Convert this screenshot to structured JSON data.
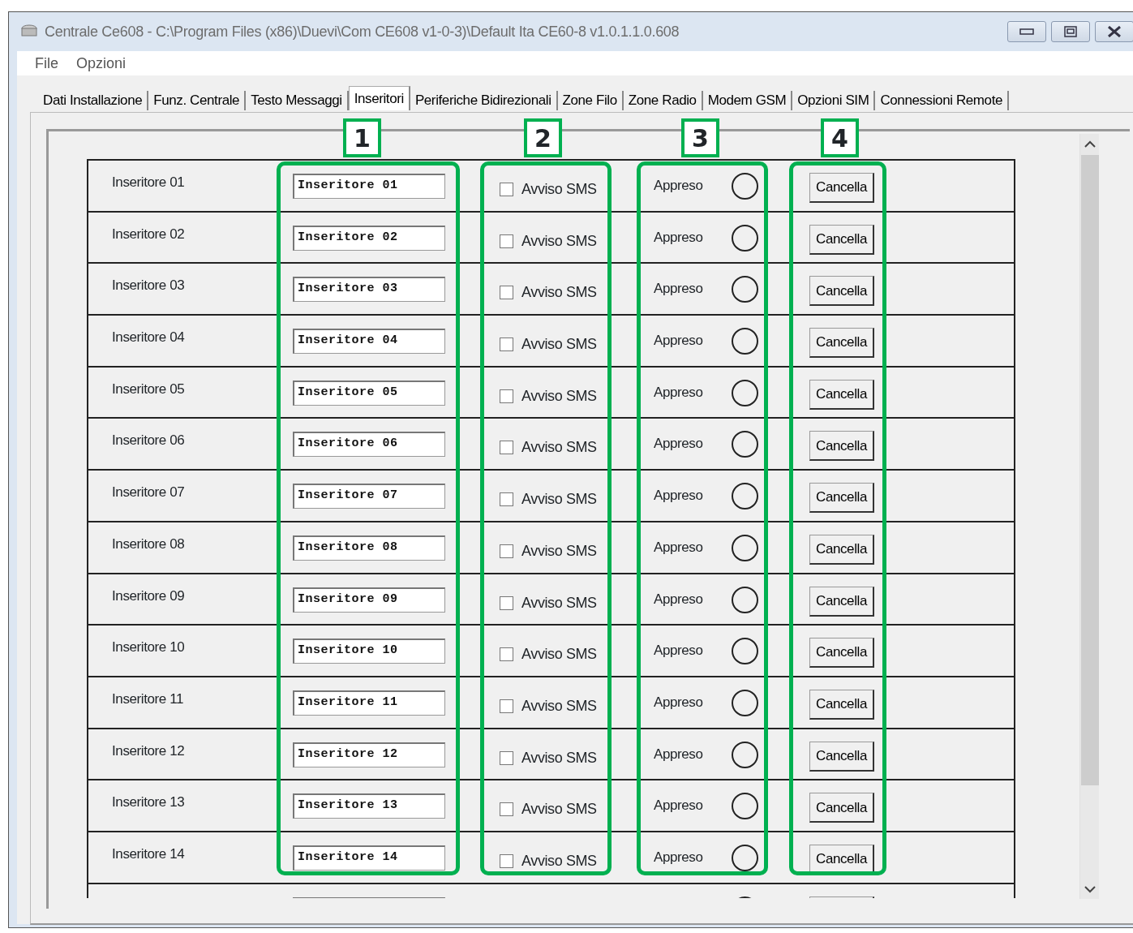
{
  "window": {
    "title": "Centrale Ce608 - C:\\Program Files (x86)\\Duevi\\Com CE608 v1-0-3)\\Default Ita CE60-8 v1.0.1.1.0.608"
  },
  "menu": [
    "File",
    "Opzioni"
  ],
  "tabs": [
    {
      "label": "Dati Installazione",
      "selected": false
    },
    {
      "label": "Funz. Centrale",
      "selected": false
    },
    {
      "label": "Testo Messaggi",
      "selected": false
    },
    {
      "label": "Inseritori",
      "selected": true
    },
    {
      "label": "Periferiche Bidirezionali",
      "selected": false
    },
    {
      "label": "Zone Filo",
      "selected": false
    },
    {
      "label": "Zone Radio",
      "selected": false
    },
    {
      "label": "Modem GSM",
      "selected": false
    },
    {
      "label": "Opzioni SIM",
      "selected": false
    },
    {
      "label": "Connessioni Remote",
      "selected": false
    }
  ],
  "callouts": [
    "1",
    "2",
    "3",
    "4"
  ],
  "rows": [
    {
      "label": "Inseritore 01",
      "name": "Inseritore 01",
      "sms_label": "Avviso SMS",
      "sms_checked": false,
      "status": "Appreso",
      "lit": false,
      "button": "Cancella"
    },
    {
      "label": "Inseritore 02",
      "name": "Inseritore 02",
      "sms_label": "Avviso SMS",
      "sms_checked": false,
      "status": "Appreso",
      "lit": false,
      "button": "Cancella"
    },
    {
      "label": "Inseritore 03",
      "name": "Inseritore 03",
      "sms_label": "Avviso SMS",
      "sms_checked": false,
      "status": "Appreso",
      "lit": false,
      "button": "Cancella"
    },
    {
      "label": "Inseritore 04",
      "name": "Inseritore 04",
      "sms_label": "Avviso SMS",
      "sms_checked": false,
      "status": "Appreso",
      "lit": false,
      "button": "Cancella"
    },
    {
      "label": "Inseritore 05",
      "name": "Inseritore 05",
      "sms_label": "Avviso SMS",
      "sms_checked": false,
      "status": "Appreso",
      "lit": false,
      "button": "Cancella"
    },
    {
      "label": "Inseritore 06",
      "name": "Inseritore 06",
      "sms_label": "Avviso SMS",
      "sms_checked": false,
      "status": "Appreso",
      "lit": false,
      "button": "Cancella"
    },
    {
      "label": "Inseritore 07",
      "name": "Inseritore 07",
      "sms_label": "Avviso SMS",
      "sms_checked": false,
      "status": "Appreso",
      "lit": false,
      "button": "Cancella"
    },
    {
      "label": "Inseritore 08",
      "name": "Inseritore 08",
      "sms_label": "Avviso SMS",
      "sms_checked": false,
      "status": "Appreso",
      "lit": false,
      "button": "Cancella"
    },
    {
      "label": "Inseritore 09",
      "name": "Inseritore 09",
      "sms_label": "Avviso SMS",
      "sms_checked": false,
      "status": "Appreso",
      "lit": false,
      "button": "Cancella"
    },
    {
      "label": "Inseritore 10",
      "name": "Inseritore 10",
      "sms_label": "Avviso SMS",
      "sms_checked": false,
      "status": "Appreso",
      "lit": false,
      "button": "Cancella"
    },
    {
      "label": "Inseritore 11",
      "name": "Inseritore 11",
      "sms_label": "Avviso SMS",
      "sms_checked": false,
      "status": "Appreso",
      "lit": false,
      "button": "Cancella"
    },
    {
      "label": "Inseritore 12",
      "name": "Inseritore 12",
      "sms_label": "Avviso SMS",
      "sms_checked": false,
      "status": "Appreso",
      "lit": false,
      "button": "Cancella"
    },
    {
      "label": "Inseritore 13",
      "name": "Inseritore 13",
      "sms_label": "Avviso SMS",
      "sms_checked": false,
      "status": "Appreso",
      "lit": false,
      "button": "Cancella"
    },
    {
      "label": "Inseritore 14",
      "name": "Inseritore 14",
      "sms_label": "Avviso SMS",
      "sms_checked": false,
      "status": "Appreso",
      "lit": false,
      "button": "Cancella"
    }
  ]
}
